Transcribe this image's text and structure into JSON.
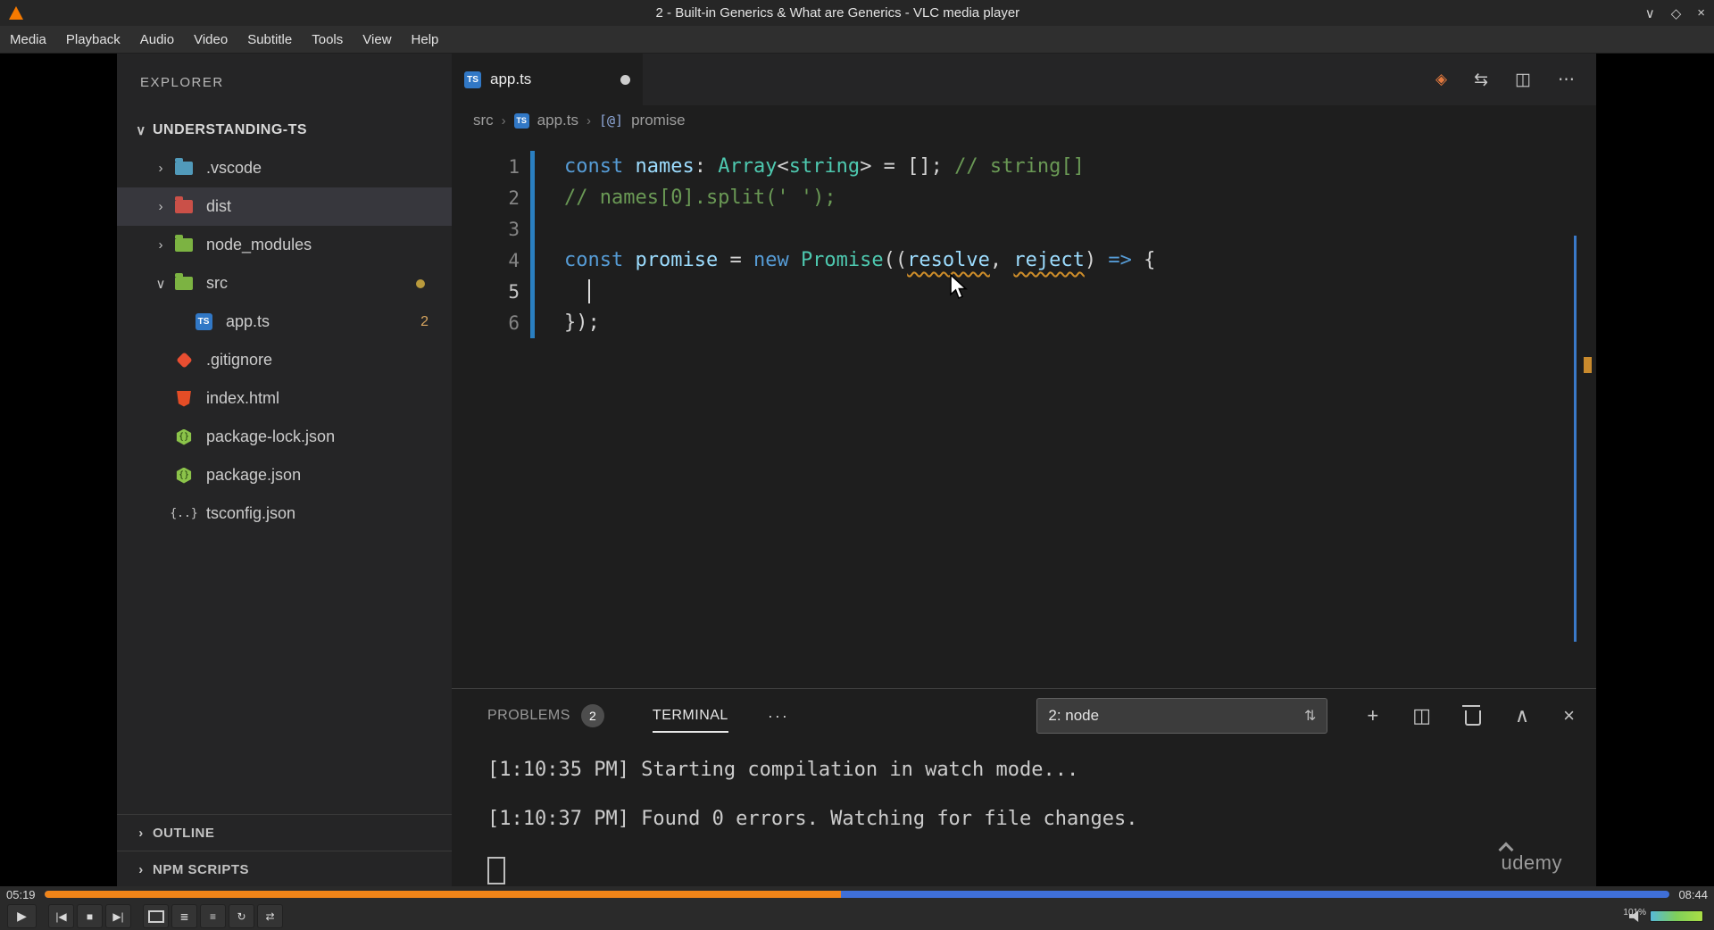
{
  "vlc": {
    "window_title": "2 - Built-in Generics & What are Generics - VLC media player",
    "menu_items": [
      "Media",
      "Playback",
      "Audio",
      "Video",
      "Subtitle",
      "Tools",
      "View",
      "Help"
    ],
    "seek": {
      "elapsed": "05:19",
      "total": "08:44",
      "progress_percent": 49
    },
    "volume_label": "101%"
  },
  "icons": {
    "win_minimize": "∨",
    "win_maximize": "◇",
    "win_close": "×",
    "chevron_down": "∨",
    "chevron_right": "›",
    "breadcrumb_sep": "›",
    "ts_label": "TS",
    "json_braces": "{}",
    "tsconfig_braces": "{..}",
    "symbol_promise": "[@]",
    "open_changes": "◈",
    "compare": "⇆",
    "split_editor": "◫",
    "more": "⋯",
    "panel_more": "···",
    "select_arrows": "⇅",
    "plus": "+",
    "panel_chevron_up": "∧",
    "panel_close": "×",
    "play": "▶",
    "previous": "|◀",
    "stop": "■",
    "next": "▶|",
    "extended": "≣",
    "playlist": "≡",
    "loop": "↻",
    "shuffle": "⇄"
  },
  "vscode": {
    "explorer": {
      "title": "EXPLORER",
      "root_label": "UNDERSTANDING-TS",
      "items": [
        ".vscode",
        "dist",
        "node_modules",
        "src",
        "app.ts",
        ".gitignore",
        "index.html",
        "package-lock.json",
        "package.json",
        "tsconfig.json"
      ],
      "app_badge": "2",
      "sections": [
        "OUTLINE",
        "NPM SCRIPTS"
      ]
    },
    "editor": {
      "tab_label": "app.ts",
      "breadcrumbs": {
        "folder": "src",
        "file": "app.ts",
        "symbol": "promise"
      },
      "lines": [
        {
          "num": "1",
          "tokens": [
            "const ",
            "names",
            ": ",
            "Array",
            "<",
            "string",
            "> = []; ",
            "// string[]"
          ]
        },
        {
          "num": "2",
          "tokens": [
            "// names[0].split(' ');"
          ]
        },
        {
          "num": "3",
          "tokens": []
        },
        {
          "num": "4",
          "tokens": [
            "const ",
            "promise",
            " = ",
            "new ",
            "Promise",
            "((",
            "resolve",
            ", ",
            "reject",
            ") ",
            "=>",
            " {"
          ]
        },
        {
          "num": "5",
          "tokens": [
            "  "
          ]
        },
        {
          "num": "6",
          "tokens": [
            "});"
          ]
        }
      ]
    },
    "panel": {
      "problems_label": "PROBLEMS",
      "problems_count": "2",
      "terminal_label": "TERMINAL",
      "shell_selector": "2: node",
      "output": [
        "[1:10:35 PM] Starting compilation in watch mode...",
        "[1:10:37 PM] Found 0 errors. Watching for file changes."
      ]
    },
    "watermark": "udemy"
  }
}
